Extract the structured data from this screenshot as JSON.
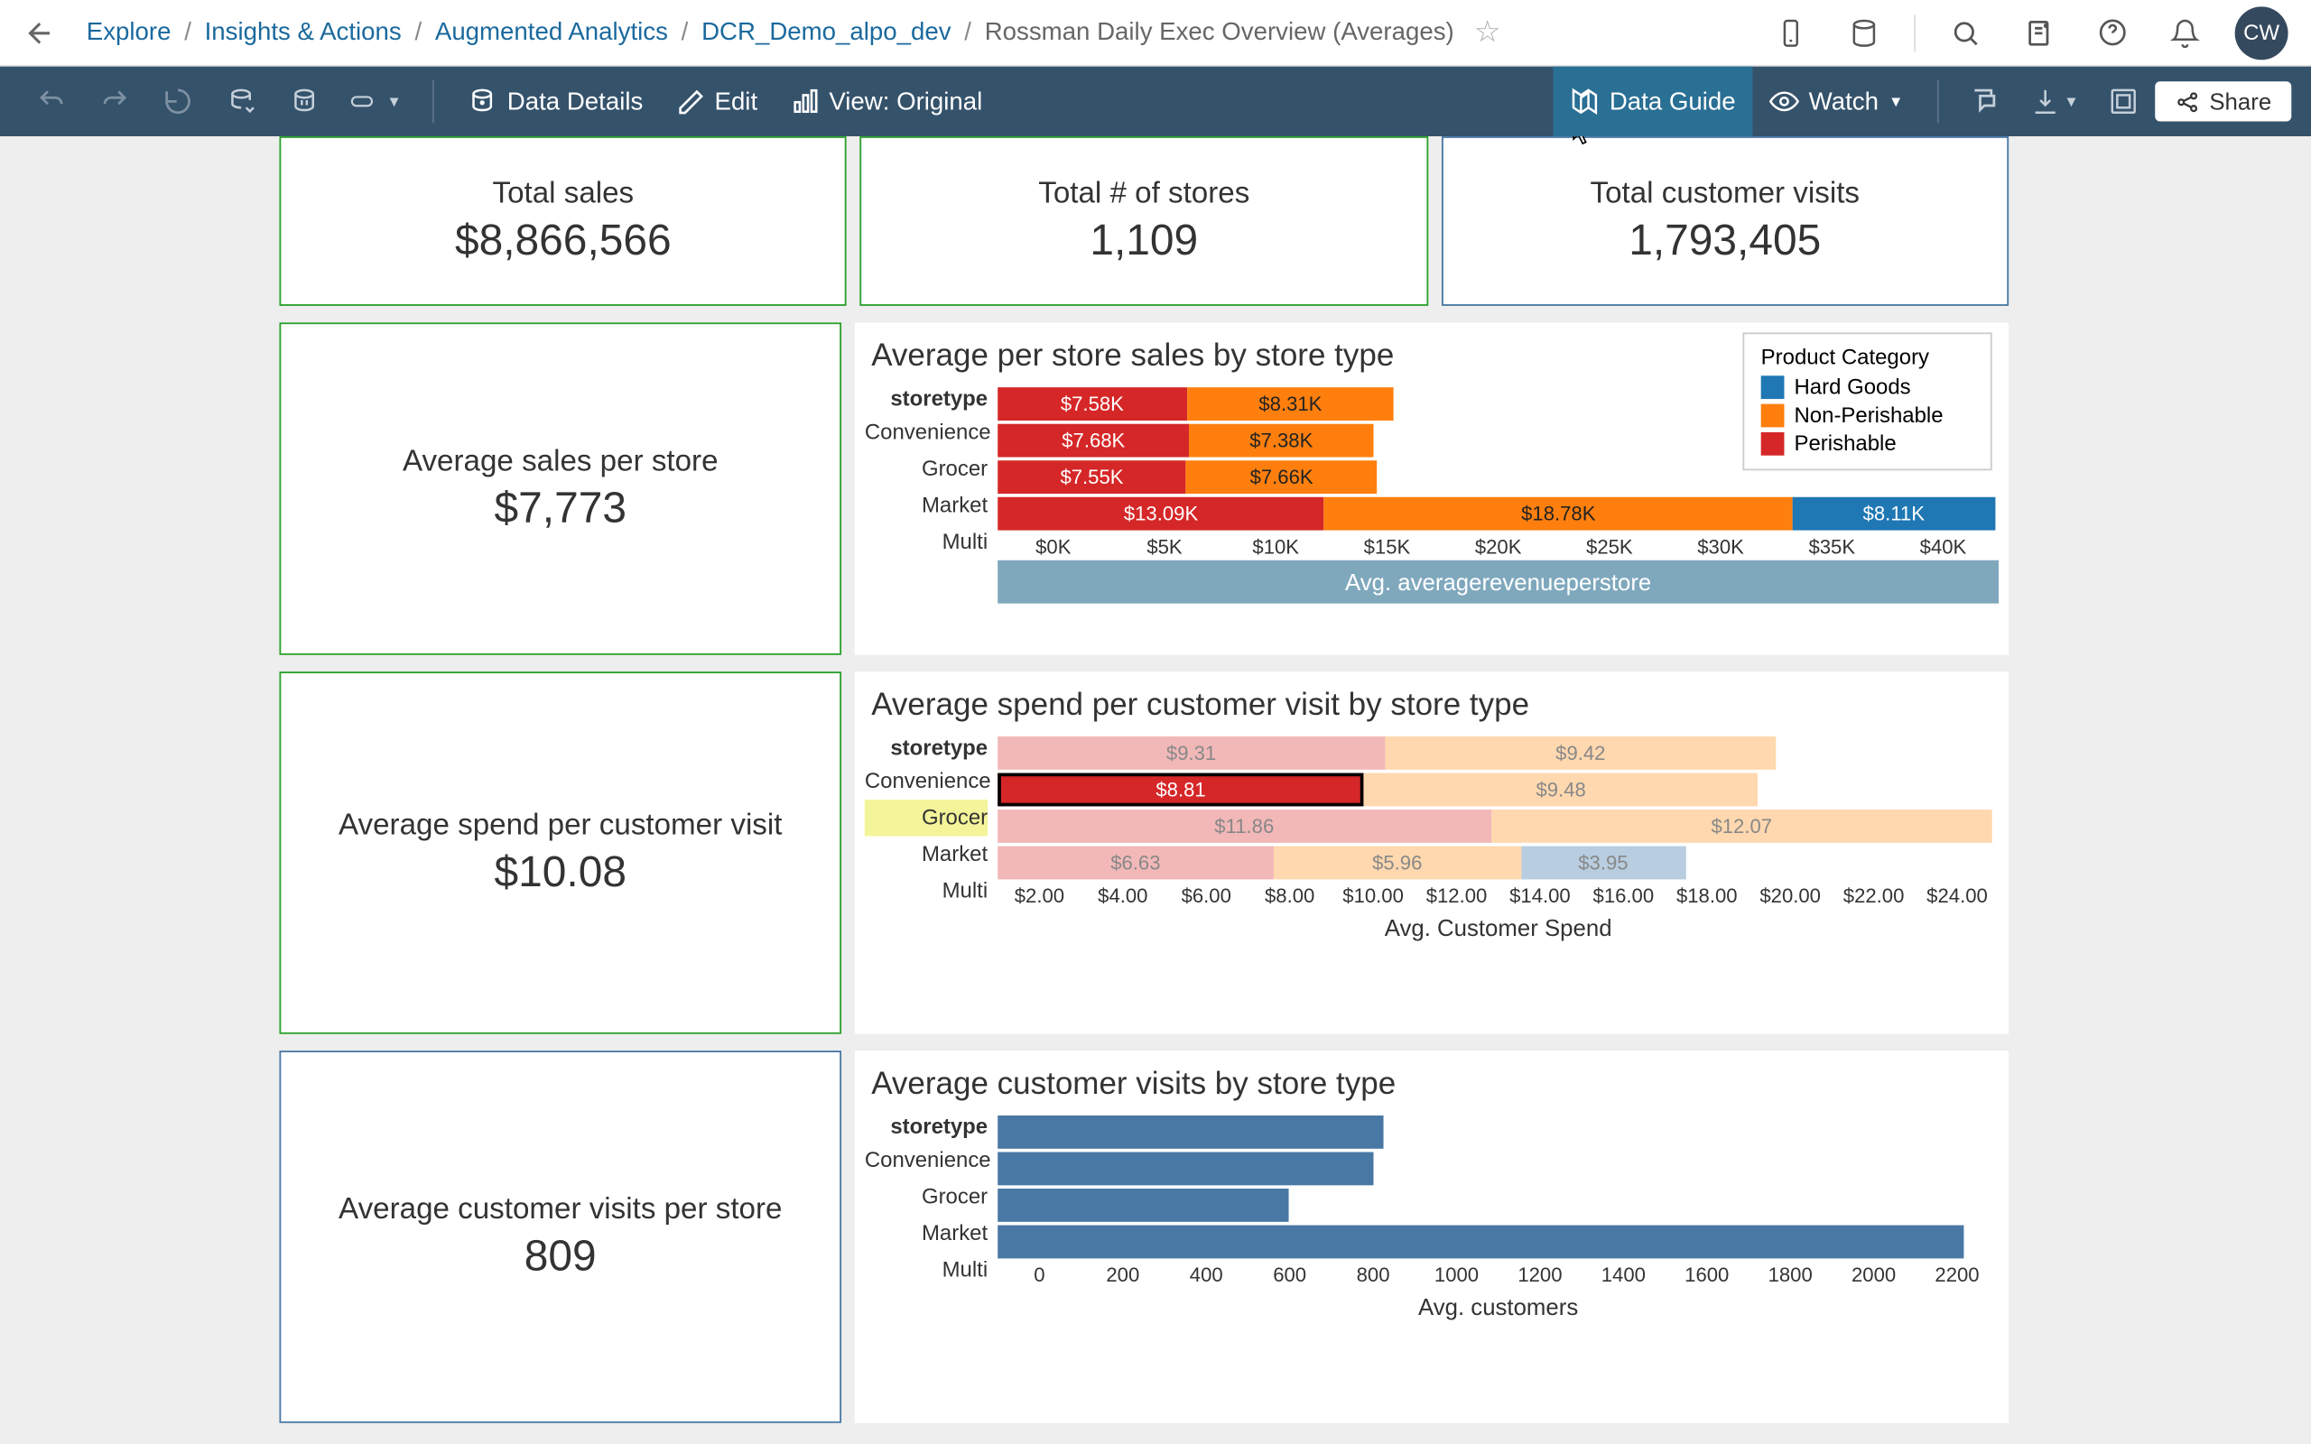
{
  "breadcrumb": {
    "items": [
      "Explore",
      "Insights & Actions",
      "Augmented Analytics",
      "DCR_Demo_alpo_dev"
    ],
    "current": "Rossman Daily Exec Overview (Averages)"
  },
  "avatar": "CW",
  "toolbar": {
    "data_details": "Data Details",
    "edit": "Edit",
    "view": "View: Original",
    "data_guide": "Data Guide",
    "watch": "Watch",
    "share": "Share"
  },
  "kpis_top": [
    {
      "label": "Total sales",
      "value": "$8,866,566",
      "style": "green"
    },
    {
      "label": "Total # of stores",
      "value": "1,109",
      "style": "green"
    },
    {
      "label": "Total customer visits",
      "value": "1,793,405",
      "style": "blue"
    }
  ],
  "sections": [
    {
      "side": {
        "label": "Average sales per store",
        "value": "$7,773",
        "style": "green"
      },
      "chart_title": "Average per store sales by store type",
      "chart_id": "c1"
    },
    {
      "side": {
        "label": "Average spend per customer visit",
        "value": "$10.08",
        "style": "green"
      },
      "chart_title": "Average spend per customer visit by store type",
      "chart_id": "c2"
    },
    {
      "side": {
        "label": "Average customer visits per store",
        "value": "809",
        "style": "blue"
      },
      "chart_title": "Average customer visits by store type",
      "chart_id": "c3"
    }
  ],
  "legend": {
    "title": "Product Category",
    "items": [
      {
        "name": "Hard Goods",
        "color": "#1f77b4"
      },
      {
        "name": "Non-Perishable",
        "color": "#ff7f0e"
      },
      {
        "name": "Perishable",
        "color": "#d62728"
      }
    ]
  },
  "chart_data": [
    {
      "id": "c1",
      "type": "bar",
      "orientation": "horizontal-stacked",
      "yhead": "storetype",
      "categories": [
        "Convenience",
        "Grocer",
        "Market",
        "Multi"
      ],
      "series": [
        {
          "name": "Perishable",
          "color": "red",
          "values": [
            7.58,
            7.68,
            7.55,
            13.09
          ],
          "labels": [
            "$7.58K",
            "$7.68K",
            "$7.55K",
            "$13.09K"
          ]
        },
        {
          "name": "Non-Perishable",
          "color": "orange",
          "values": [
            8.31,
            7.38,
            7.66,
            18.78
          ],
          "labels": [
            "$8.31K",
            "$7.38K",
            "$7.66K",
            "$18.78K"
          ]
        },
        {
          "name": "Hard Goods",
          "color": "blue",
          "values": [
            0,
            0,
            0,
            8.11
          ],
          "labels": [
            "",
            "",
            "",
            "$8.11K"
          ]
        }
      ],
      "xticks": [
        "$0K",
        "$5K",
        "$10K",
        "$15K",
        "$20K",
        "$25K",
        "$30K",
        "$35K",
        "$40K"
      ],
      "xmax": 40,
      "xlabel": "Avg. averagerevenueperstore",
      "xlabel_band": true
    },
    {
      "id": "c2",
      "type": "bar",
      "orientation": "horizontal-stacked",
      "yhead": "storetype",
      "categories": [
        "Convenience",
        "Grocer",
        "Market",
        "Multi"
      ],
      "highlighted_row": 1,
      "series": [
        {
          "name": "Perishable",
          "color": "red",
          "values": [
            9.31,
            8.81,
            11.86,
            6.63
          ],
          "labels": [
            "$9.31",
            "$8.81",
            "$11.86",
            "$6.63"
          ]
        },
        {
          "name": "Non-Perishable",
          "color": "orange",
          "values": [
            9.42,
            9.48,
            12.07,
            5.96
          ],
          "labels": [
            "$9.42",
            "$9.48",
            "$12.07",
            "$5.96"
          ]
        },
        {
          "name": "Hard Goods",
          "color": "blue",
          "values": [
            0,
            0,
            0,
            3.95
          ],
          "labels": [
            "",
            "",
            "",
            "$3.95"
          ]
        }
      ],
      "xticks": [
        "$2.00",
        "$4.00",
        "$6.00",
        "$8.00",
        "$10.00",
        "$12.00",
        "$14.00",
        "$16.00",
        "$18.00",
        "$20.00",
        "$22.00",
        "$24.00"
      ],
      "xmax": 24,
      "xlabel": "Avg. Customer Spend"
    },
    {
      "id": "c3",
      "type": "bar",
      "orientation": "horizontal",
      "yhead": "storetype",
      "categories": [
        "Convenience",
        "Grocer",
        "Market",
        "Multi"
      ],
      "values": [
        850,
        830,
        640,
        2130
      ],
      "color": "#4a78a4",
      "xticks": [
        "0",
        "200",
        "400",
        "600",
        "800",
        "1000",
        "1200",
        "1400",
        "1600",
        "1800",
        "2000",
        "2200"
      ],
      "xmax": 2200,
      "xlabel": "Avg. customers"
    }
  ]
}
